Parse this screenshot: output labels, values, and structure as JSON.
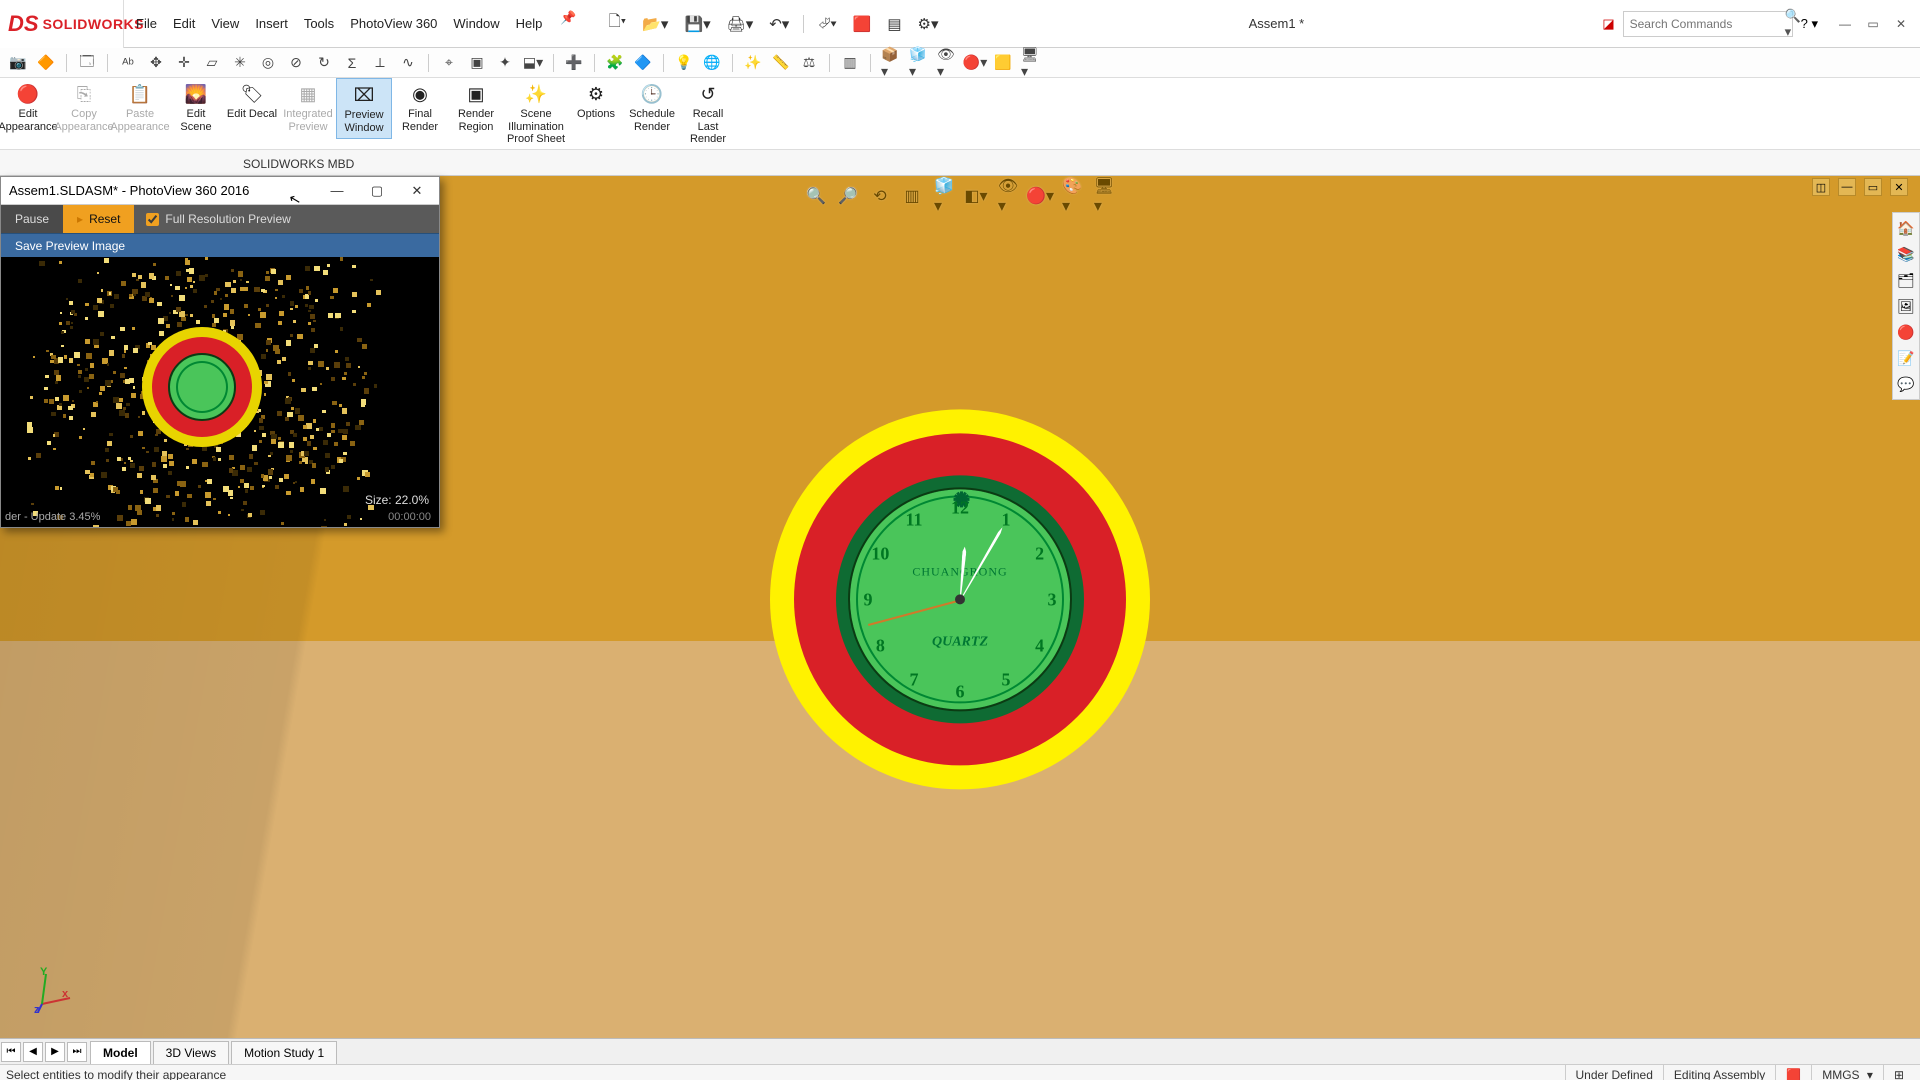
{
  "app": {
    "brand": "SOLIDWORKS",
    "doc_title": "Assem1 *",
    "search_placeholder": "Search Commands"
  },
  "menu": [
    "File",
    "Edit",
    "View",
    "Insert",
    "Tools",
    "PhotoView 360",
    "Window",
    "Help"
  ],
  "ribbon": [
    {
      "label": "Edit\nAppearance",
      "ico": "🎨",
      "state": "normal"
    },
    {
      "label": "Copy\nAppearance",
      "ico": "📋",
      "state": "disabled"
    },
    {
      "label": "Paste\nAppearance",
      "ico": "📋",
      "state": "disabled"
    },
    {
      "label": "Edit\nScene",
      "ico": "🌄",
      "state": "normal"
    },
    {
      "label": "Edit\nDecal",
      "ico": "🏷",
      "state": "normal"
    },
    {
      "label": "Integrated\nPreview",
      "ico": "▦",
      "state": "disabled"
    },
    {
      "label": "Preview\nWindow",
      "ico": "⌧",
      "state": "active"
    },
    {
      "label": "Final\nRender",
      "ico": "◉",
      "state": "normal"
    },
    {
      "label": "Render\nRegion",
      "ico": "▣",
      "state": "normal"
    },
    {
      "label": "Scene\nIllumination\nProof Sheet",
      "ico": "✨",
      "state": "normal",
      "wide": true
    },
    {
      "label": "Options",
      "ico": "⚙",
      "state": "normal"
    },
    {
      "label": "Schedule\nRender",
      "ico": "🕒",
      "state": "normal"
    },
    {
      "label": "Recall\nLast\nRender",
      "ico": "↺",
      "state": "normal"
    }
  ],
  "cmd_tabs": [
    "SOLIDWORKS MBD"
  ],
  "pvwin": {
    "title": "Assem1.SLDASM* - PhotoView 360 2016",
    "pause": "Pause",
    "reset": "Reset",
    "full_res": "Full Resolution Preview",
    "save_img": "Save Preview Image",
    "status": "der - Update 3.45%",
    "size": "Size: 22.0%",
    "time": "00:00:00"
  },
  "clock": {
    "brand": "CHUANGRONG",
    "quartz": "QUARTZ",
    "numbers": [
      "12",
      "1",
      "2",
      "3",
      "4",
      "5",
      "6",
      "7",
      "8",
      "9",
      "10",
      "11"
    ]
  },
  "bottom_tabs": [
    "Model",
    "3D Views",
    "Motion Study 1"
  ],
  "status": {
    "hint": "Select entities to modify their appearance",
    "state1": "Under Defined",
    "state2": "Editing Assembly",
    "units": "MMGS"
  }
}
